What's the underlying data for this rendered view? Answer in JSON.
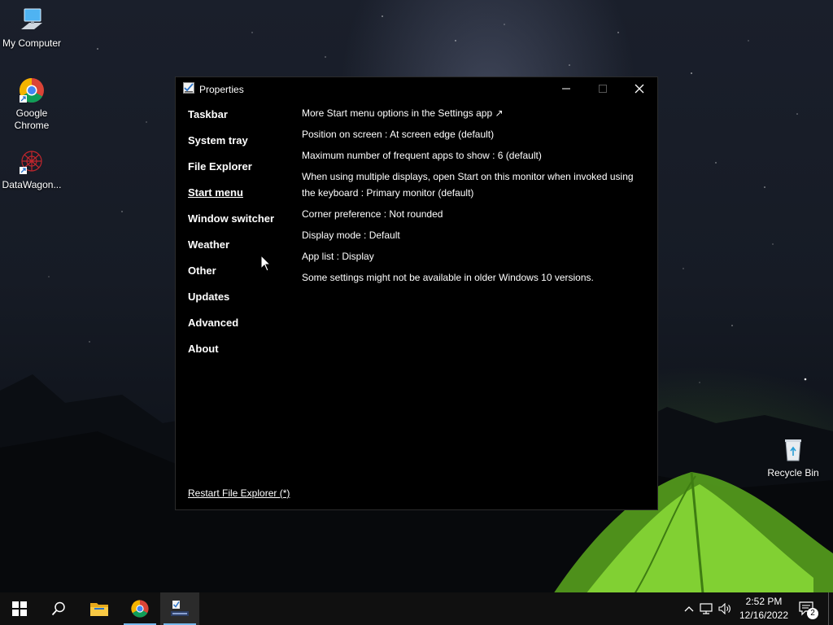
{
  "desktop": {
    "icons": [
      {
        "label": "My Computer"
      },
      {
        "label": "Google Chrome"
      },
      {
        "label": "DataWagon..."
      },
      {
        "label": "Recycle Bin"
      }
    ]
  },
  "window": {
    "title": "Properties",
    "nav": [
      {
        "label": "Taskbar"
      },
      {
        "label": "System tray"
      },
      {
        "label": "File Explorer"
      },
      {
        "label": "Start menu",
        "active": true
      },
      {
        "label": "Window switcher"
      },
      {
        "label": "Weather"
      },
      {
        "label": "Other"
      },
      {
        "label": "Updates"
      },
      {
        "label": "Advanced"
      },
      {
        "label": "About"
      }
    ],
    "settings": [
      "More Start menu options in the Settings app ↗",
      "Position on screen : At screen edge (default)",
      "Maximum number of frequent apps to show : 6 (default)",
      "When using multiple displays, open Start on this monitor when invoked using the keyboard : Primary monitor (default)",
      "Corner preference : Not rounded",
      "Display mode : Default",
      "App list : Display",
      "Some settings might not be available in older Windows 10 versions."
    ],
    "restart_link": "Restart File Explorer (*)"
  },
  "taskbar": {
    "clock_time": "2:52 PM",
    "clock_date": "12/16/2022",
    "notification_count": "2"
  },
  "colors": {
    "taskbar_bg": "#101010",
    "window_bg": "#000000",
    "accent": "#76b9ed"
  }
}
